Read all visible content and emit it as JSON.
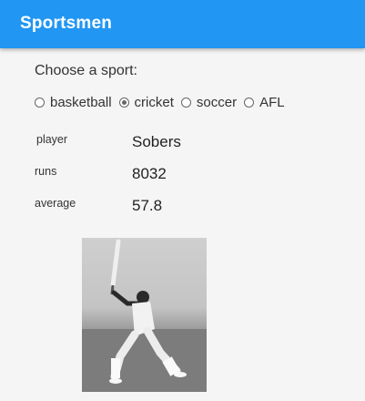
{
  "appbar": {
    "title": "Sportsmen"
  },
  "prompt": "Choose a sport:",
  "sports": [
    {
      "label": "basketball",
      "checked": false
    },
    {
      "label": "cricket",
      "checked": true
    },
    {
      "label": "soccer",
      "checked": false
    },
    {
      "label": "AFL",
      "checked": false
    }
  ],
  "details": {
    "player_label": "player",
    "player_value": "Sobers",
    "runs_label": "runs",
    "runs_value": "8032",
    "average_label": "average",
    "average_value": "57.8"
  },
  "colors": {
    "appbar": "#2196f3",
    "background": "#f5f5f5"
  }
}
